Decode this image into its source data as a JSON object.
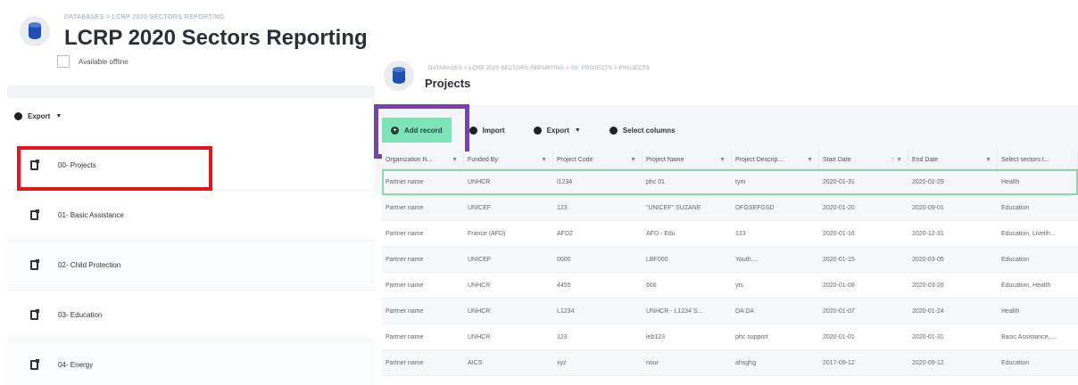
{
  "database": {
    "breadcrumb": "DATABASES > LCRP 2020 SECTORS REPORTING",
    "title": "LCRP 2020 Sectors Reporting",
    "available_offline": "Available offline",
    "export_label": "Export",
    "folders": [
      {
        "label": "00- Projects"
      },
      {
        "label": "01- Basic Assistance"
      },
      {
        "label": "02- Child Protection"
      },
      {
        "label": "03- Education"
      },
      {
        "label": "04- Energy"
      }
    ]
  },
  "form": {
    "breadcrumb": "DATABASES > LCRP 2020 SECTORS REPORTING > 00- PROJECTS > PROJECTS",
    "title": "Projects",
    "toolbar": {
      "add_record": "Add record",
      "import": "Import",
      "export": "Export",
      "select_columns": "Select columns"
    },
    "columns": [
      "Organization N...",
      "Funded By",
      "Project Code",
      "Project Name",
      "Project Descrip...",
      "Start Date",
      "End Date",
      "Select sectors t..."
    ],
    "rows": [
      [
        "Partner name",
        "UNHCR",
        "l1234",
        "phc 01",
        "tym",
        "2020-01-31",
        "2020-02-29",
        "Health"
      ],
      [
        "Partner name",
        "UNICEF",
        "123",
        "\"UNICEF\" SUZANE",
        "DFGSEFGSD",
        "2020-01-20",
        "2020-09-01",
        "Education"
      ],
      [
        "Partner name",
        "France (AFD)",
        "AFD2",
        "AFD - Edu",
        "123",
        "2020-01-16",
        "2020-12-31",
        "Education, Livelih..."
      ],
      [
        "Partner name",
        "UNICEF",
        "0000",
        "LBF000",
        "Youth....",
        "2020-01-15",
        "2020-03-05",
        "Education"
      ],
      [
        "Partner name",
        "UNHCR",
        "4455",
        "666",
        "yts",
        "2020-01-08",
        "2020-03-26",
        "Education, Health"
      ],
      [
        "Partner name",
        "UNHCR",
        "L1234",
        "UNHCR - L1234 S...",
        "DA DA",
        "2020-01-07",
        "2020-01-24",
        "Health"
      ],
      [
        "Partner name",
        "UNHCR",
        "123",
        "leb123",
        "phc support",
        "2020-01-01",
        "2020-01-31",
        "Basic Assistance, ..."
      ],
      [
        "Partner name",
        "AICS",
        "xyz",
        "nour",
        "ahsghg",
        "2017-09-12",
        "2020-09-12",
        "Education"
      ]
    ]
  }
}
